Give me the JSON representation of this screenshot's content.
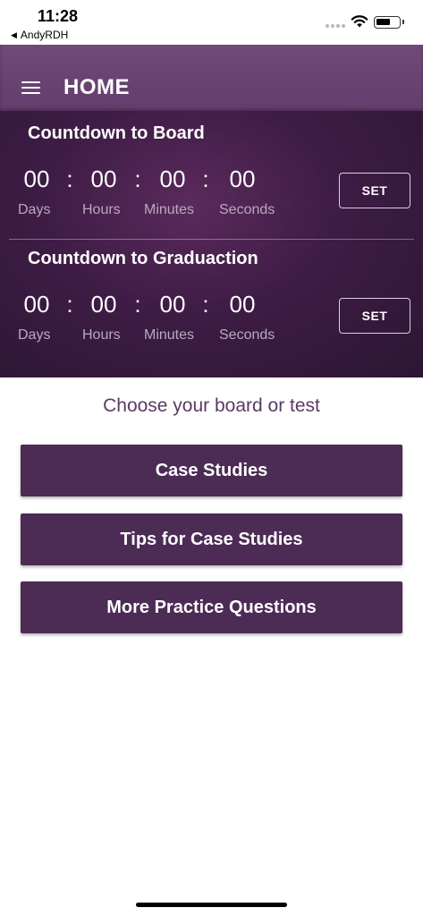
{
  "status_bar": {
    "time": "11:28",
    "back_app": "AndyRDH",
    "back_arrow": "◀"
  },
  "header": {
    "title": "HOME",
    "menu_icon": "hamburger-icon",
    "color": "#6a4573"
  },
  "countdowns": [
    {
      "title": "Countdown to Board",
      "days": "00",
      "hours": "00",
      "minutes": "00",
      "seconds": "00",
      "set_label": "SET"
    },
    {
      "title": "Countdown to Graduaction",
      "days": "00",
      "hours": "00",
      "minutes": "00",
      "seconds": "00",
      "set_label": "SET"
    }
  ],
  "units": {
    "days": "Days",
    "hours": "Hours",
    "minutes": "Minutes",
    "seconds": "Seconds",
    "separator": ":"
  },
  "choose": {
    "prompt": "Choose your board or test",
    "buttons": [
      {
        "label": "Case Studies"
      },
      {
        "label": "Tips for Case Studies"
      },
      {
        "label": "More Practice Questions"
      }
    ]
  },
  "colors": {
    "brand_purple": "#4c2b55",
    "panel_dark": "#3e1c45"
  }
}
